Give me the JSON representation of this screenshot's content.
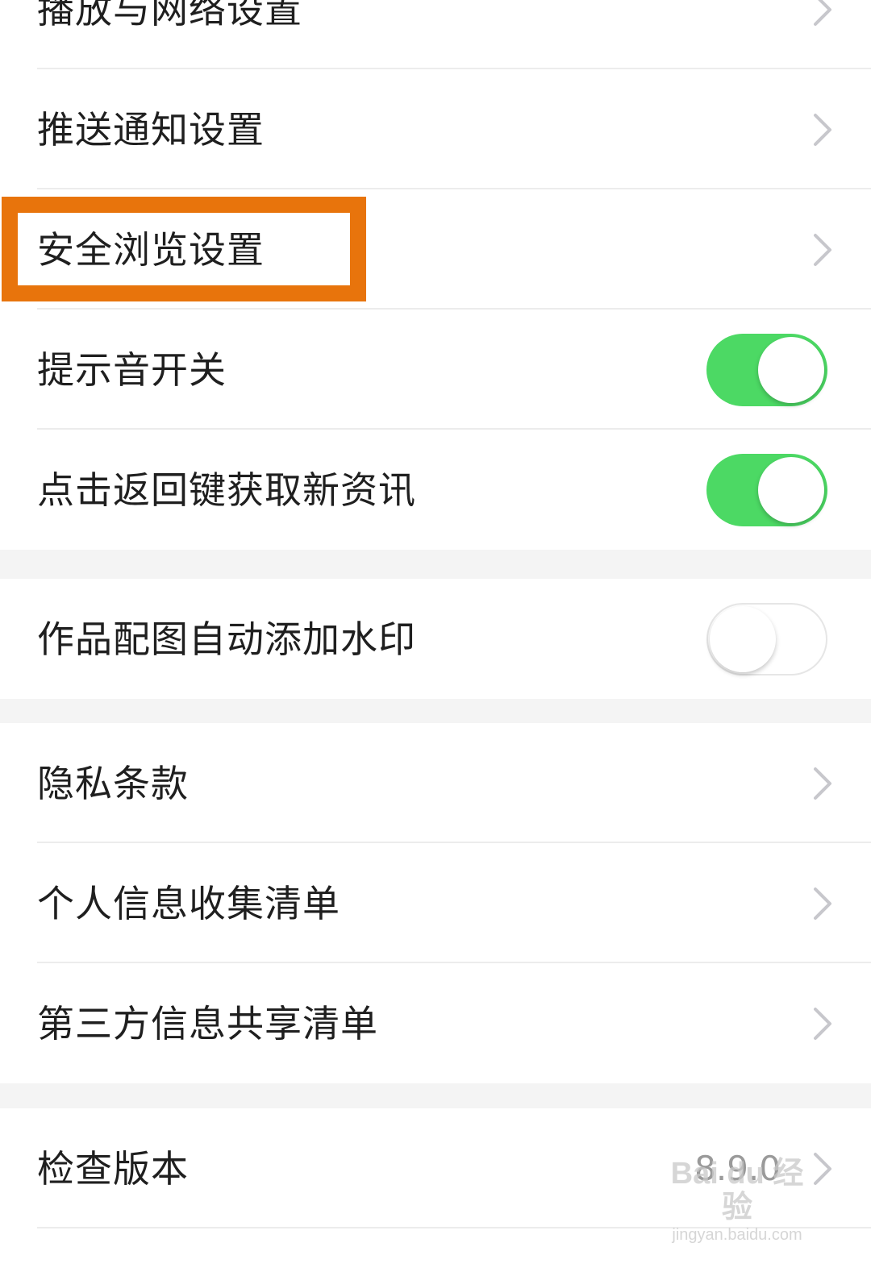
{
  "settings": {
    "group1": [
      {
        "label": "播放与网络设置",
        "control": "chevron"
      },
      {
        "label": "推送通知设置",
        "control": "chevron"
      },
      {
        "label": "安全浏览设置",
        "control": "chevron",
        "highlighted": true
      },
      {
        "label": "提示音开关",
        "control": "toggle",
        "on": true
      },
      {
        "label": "点击返回键获取新资讯",
        "control": "toggle",
        "on": true
      }
    ],
    "group2": [
      {
        "label": "作品配图自动添加水印",
        "control": "toggle",
        "on": false
      }
    ],
    "group3": [
      {
        "label": "隐私条款",
        "control": "chevron"
      },
      {
        "label": "个人信息收集清单",
        "control": "chevron"
      },
      {
        "label": "第三方信息共享清单",
        "control": "chevron"
      }
    ],
    "group4": [
      {
        "label": "检查版本",
        "control": "chevron",
        "value": "8.9.0"
      }
    ]
  },
  "highlight_color": "#e8740c",
  "toggle_on_color": "#4cd964",
  "watermark": {
    "main": "Bai du 经验",
    "sub": "jingyan.baidu.com"
  }
}
